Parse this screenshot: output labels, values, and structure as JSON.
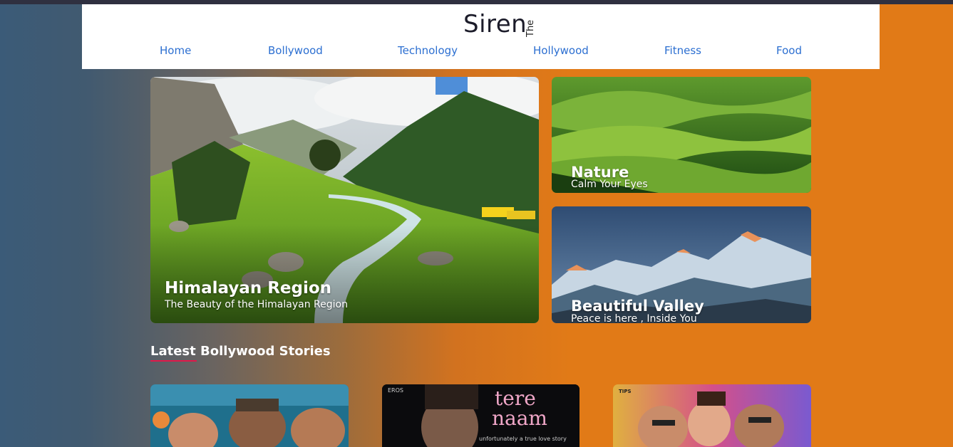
{
  "logo": {
    "small": "The",
    "main": "Siren"
  },
  "nav": [
    "Home",
    "Bollywood",
    "Technology",
    "Hollywood",
    "Fitness",
    "Food"
  ],
  "hero": {
    "main": {
      "title": "Himalayan Region",
      "subtitle": "The Beauty of the Himalayan Region"
    },
    "side1": {
      "title": "Nature",
      "subtitle": "Calm Your Eyes"
    },
    "side2": {
      "title": "Beautiful Valley",
      "subtitle": "Peace is here , Inside You"
    }
  },
  "section": {
    "title": "Latest Bollywood Stories"
  },
  "posters": [
    {
      "text": ""
    },
    {
      "brand": "EROS",
      "title_line1": "tere",
      "title_line2": "naam",
      "tagline": "unfortunately a true love story"
    },
    {
      "brand": "TIPS",
      "text": ""
    }
  ],
  "colors": {
    "nav_link": "#2c6fd1",
    "underline": "#e0184a",
    "accent_orange": "#e17a17"
  }
}
